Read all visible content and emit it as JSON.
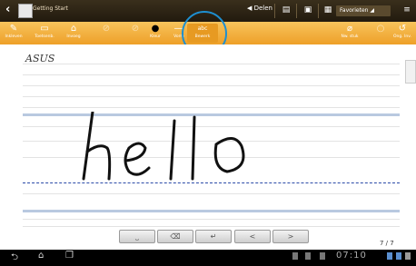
{
  "app": {
    "title": "Getting Start"
  },
  "actionbar": {
    "share_label": "Delen",
    "favorites_label": "Favorieten"
  },
  "tools": [
    {
      "label": "Inkleven",
      "icon": "pen-icon"
    },
    {
      "label": "Toetsenb.",
      "icon": "keyboard-icon"
    },
    {
      "label": "Invoeg",
      "icon": "insert-icon"
    },
    {
      "label": "",
      "icon": "undo-icon"
    },
    {
      "label": "",
      "icon": "redo-icon"
    },
    {
      "label": "Kleur",
      "icon": "color-dot-icon"
    },
    {
      "label": "Vorm",
      "icon": "stroke-icon"
    },
    {
      "label": "Bewerk",
      "icon": "edit-icon"
    },
    {
      "label": "Nw. stuk",
      "icon": "eraser-icon"
    },
    {
      "label": "",
      "icon": "blank-icon"
    },
    {
      "label": "Ong. Inv.",
      "icon": "undo-arrow-icon"
    }
  ],
  "note": {
    "header_text": "ASUS",
    "handwriting": "hello",
    "page_indicator": "7 / 7"
  },
  "keys": [
    "⎵",
    "⌫",
    "↵",
    "<",
    ">"
  ],
  "system": {
    "clock": "07:10"
  },
  "colors": {
    "accent": "#f0a12b",
    "highlight_circle": "#1e8fd0"
  }
}
